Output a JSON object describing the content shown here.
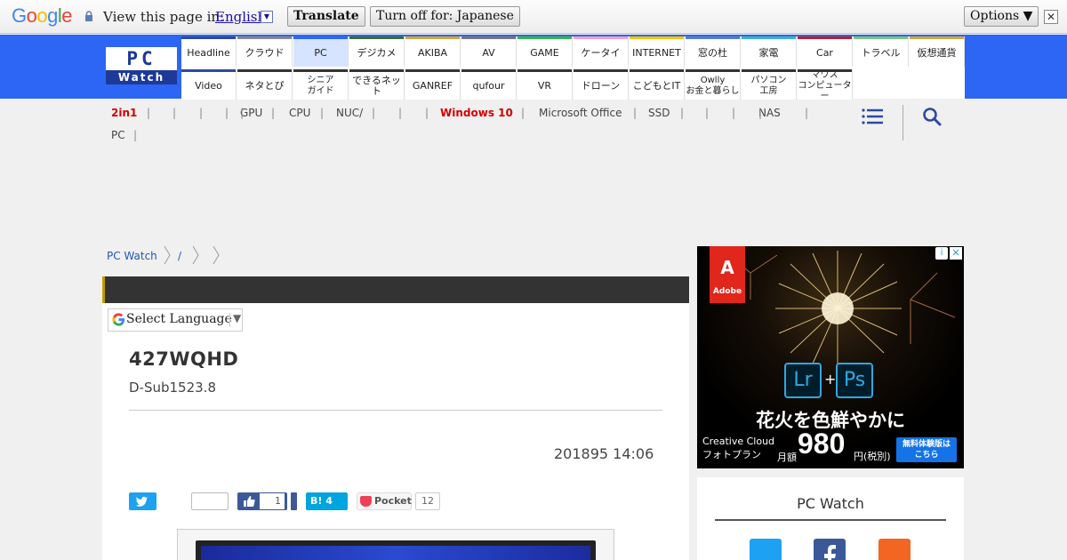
{
  "translate_bar": {
    "logo": "Google",
    "prompt": "View this page in:",
    "language": "English",
    "translate_button": "Translate",
    "turn_off_button": "Turn off for: Japanese",
    "options_button": "Options ▼",
    "close_glyph": "✕"
  },
  "logo": {
    "pc": "PC",
    "watch": "Watch"
  },
  "nav": {
    "row1": [
      {
        "label": "Headline",
        "color": "#2d4aa0"
      },
      {
        "label": "クラウド",
        "color": "#888888"
      },
      {
        "label": "PC",
        "color": "#2d66f5",
        "active": true
      },
      {
        "label": "デジカメ",
        "color": "#3c6b3c"
      },
      {
        "label": "AKIBA",
        "color": "#d8a43b"
      },
      {
        "label": "AV",
        "color": "#777777"
      },
      {
        "label": "GAME",
        "color": "#39b54a"
      },
      {
        "label": "ケータイ",
        "color": "#f2a1c6"
      },
      {
        "label": "INTERNET",
        "color": "#f5c400"
      },
      {
        "label": "窓の杜",
        "color": "#5a7fbf"
      },
      {
        "label": "家電",
        "color": "#3fb0c8"
      },
      {
        "label": "Car",
        "color": "#b5222f"
      },
      {
        "label": "トラベル",
        "color": "#7cc47f"
      },
      {
        "label": "仮想通貨",
        "color": "#d8a43b"
      }
    ],
    "row2": [
      {
        "label": "Video",
        "color": "#2d4aa0"
      },
      {
        "label": "ネタとぴ",
        "color": "#333333"
      },
      {
        "label": "シニア\nガイド",
        "color": "#333333"
      },
      {
        "label": "できるネット",
        "color": "#333333"
      },
      {
        "label": "GANREF",
        "color": "#333333"
      },
      {
        "label": "qufour",
        "color": "#333333"
      },
      {
        "label": "VR",
        "color": "#333333"
      },
      {
        "label": "ドローン",
        "color": "#333333"
      },
      {
        "label": "こどもとIT",
        "color": "#333333"
      },
      {
        "label": "Owlly\nお金と暮らし",
        "color": "#333333"
      },
      {
        "label": "パソコン\n工房",
        "color": "#333333"
      },
      {
        "label": "マウス\nコンピューター",
        "color": "#333333"
      }
    ]
  },
  "tags": {
    "row1": [
      "2in1",
      "",
      "",
      "",
      "",
      "GPU",
      "CPU",
      "NUC/",
      "",
      "",
      "",
      "Windows 10",
      "Microsoft Office",
      "SSD",
      "",
      "",
      "",
      "NAS"
    ],
    "row2": [
      "PC"
    ]
  },
  "breadcrumb": [
    "PC Watch",
    "/",
    "",
    ""
  ],
  "article": {
    "select_language": "Select Language",
    "select_arrow": "▼",
    "title": "427WQHD",
    "subtitle": "D-Sub1523.8",
    "date": "201895 14:06"
  },
  "share": {
    "facebook_count": "1",
    "hatena_label": "B! 4",
    "pocket_label": "Pocket",
    "pocket_count": "12"
  },
  "ad": {
    "brand": "Adobe",
    "brand_glyph": "A",
    "lr": "Lr",
    "plus": "+",
    "ps": "Ps",
    "headline": "花火を色鮮やかに",
    "product_line1": "Creative Cloud",
    "product_line2": "フォトプラン",
    "monthly": "月額",
    "price": "980",
    "tax": "円(税別)",
    "cta": "無料体験版は\nこちら",
    "info_glyph": "i",
    "close_glyph": "✕"
  },
  "follow": {
    "title": "PC Watch"
  }
}
